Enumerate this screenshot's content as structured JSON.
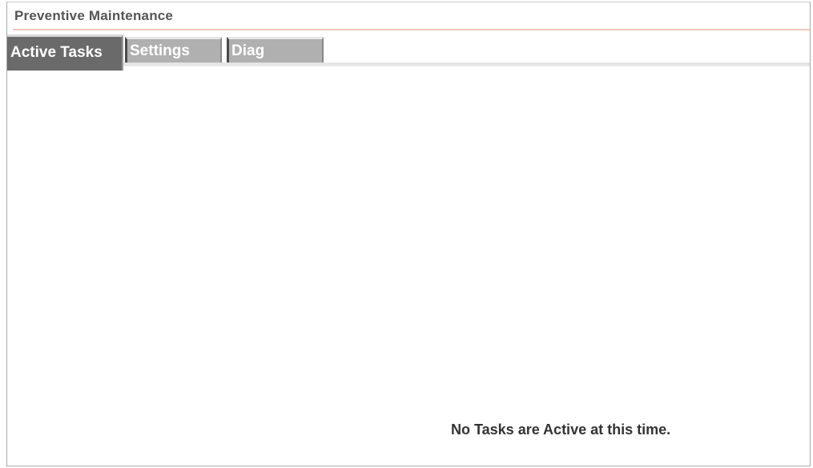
{
  "window": {
    "title": "Preventive Maintenance"
  },
  "tabs": [
    {
      "label": "Active Tasks",
      "active": true
    },
    {
      "label": "Settings",
      "active": false
    },
    {
      "label": "Diag",
      "active": false
    }
  ],
  "main": {
    "empty_message": "No Tasks are Active at this time."
  },
  "colors": {
    "active_tab_bg": "#6a6a6a",
    "inactive_tab_bg": "#b0b0b0",
    "title_rule": "#f4c4bc",
    "title_text": "#555555"
  }
}
